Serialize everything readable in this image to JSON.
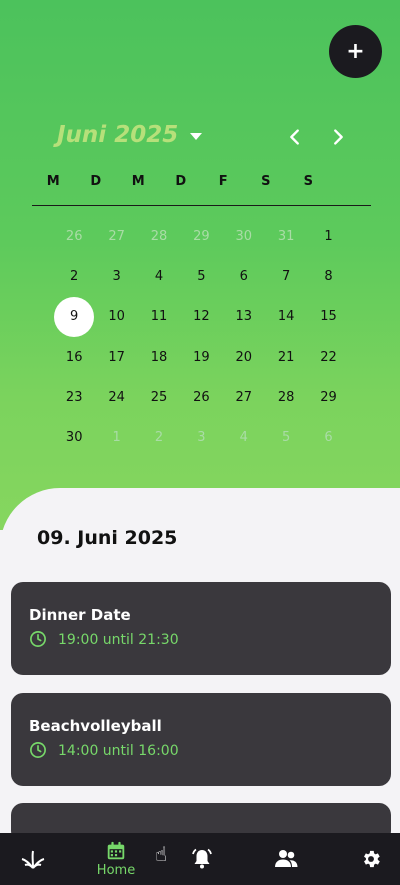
{
  "header": {
    "add_button": "+",
    "month_title": "Juni 2025"
  },
  "calendar": {
    "weekdays": [
      "M",
      "D",
      "M",
      "D",
      "F",
      "S",
      "S"
    ],
    "weeks": [
      [
        {
          "d": "26",
          "out": true
        },
        {
          "d": "27",
          "out": true
        },
        {
          "d": "28",
          "out": true
        },
        {
          "d": "29",
          "out": true
        },
        {
          "d": "30",
          "out": true
        },
        {
          "d": "31",
          "out": true
        },
        {
          "d": "1",
          "out": false
        }
      ],
      [
        {
          "d": "2",
          "out": false
        },
        {
          "d": "3",
          "out": false
        },
        {
          "d": "4",
          "out": false
        },
        {
          "d": "5",
          "out": false
        },
        {
          "d": "6",
          "out": false
        },
        {
          "d": "7",
          "out": false
        },
        {
          "d": "8",
          "out": false
        }
      ],
      [
        {
          "d": "9",
          "out": false,
          "sel": true
        },
        {
          "d": "10",
          "out": false
        },
        {
          "d": "11",
          "out": false
        },
        {
          "d": "12",
          "out": false
        },
        {
          "d": "13",
          "out": false
        },
        {
          "d": "14",
          "out": false
        },
        {
          "d": "15",
          "out": false
        }
      ],
      [
        {
          "d": "16",
          "out": false
        },
        {
          "d": "17",
          "out": false
        },
        {
          "d": "18",
          "out": false
        },
        {
          "d": "19",
          "out": false
        },
        {
          "d": "20",
          "out": false
        },
        {
          "d": "21",
          "out": false
        },
        {
          "d": "22",
          "out": false
        }
      ],
      [
        {
          "d": "23",
          "out": false
        },
        {
          "d": "24",
          "out": false
        },
        {
          "d": "25",
          "out": false
        },
        {
          "d": "26",
          "out": false
        },
        {
          "d": "27",
          "out": false
        },
        {
          "d": "28",
          "out": false
        },
        {
          "d": "29",
          "out": false
        }
      ],
      [
        {
          "d": "30",
          "out": false
        },
        {
          "d": "1",
          "out": true
        },
        {
          "d": "2",
          "out": true
        },
        {
          "d": "3",
          "out": true
        },
        {
          "d": "4",
          "out": true
        },
        {
          "d": "5",
          "out": true
        },
        {
          "d": "6",
          "out": true
        }
      ]
    ]
  },
  "selected_date": "09. Juni 2025",
  "events": [
    {
      "title": "Dinner Date",
      "time": "19:00 until 21:30"
    },
    {
      "title": "Beachvolleyball",
      "time": "14:00 until 16:00"
    }
  ],
  "bottom_nav": {
    "home_label": "Home"
  },
  "colors": {
    "accent_green": "#77d86a",
    "dark": "#1b1a1f",
    "card": "#3a383d"
  }
}
